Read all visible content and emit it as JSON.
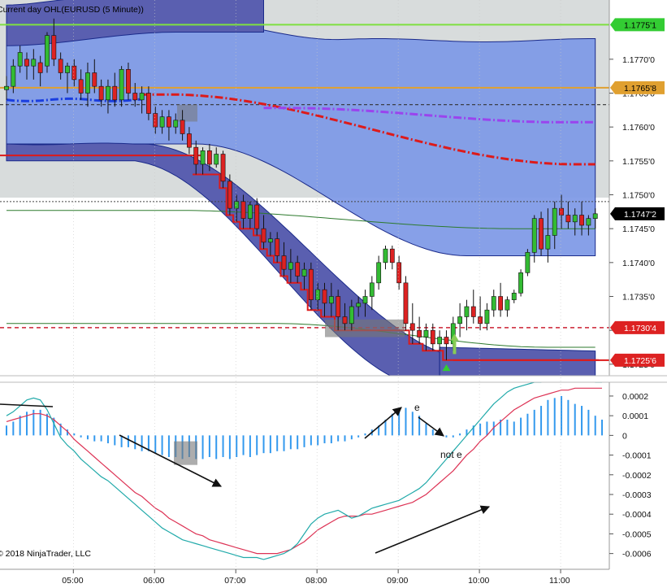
{
  "chart_data": [
    {
      "type": "candlestick",
      "title": "Current day OHL(EURUSD (5 Minute))",
      "ylim": [
        1.17233,
        1.17785
      ],
      "y_ticks": [
        "1.1770'0",
        "1.1765'0",
        "1.1760'0",
        "1.1755'0",
        "1.1750'0",
        "1.1745'0",
        "1.1740'0",
        "1.1735'0",
        "1.1730'0",
        "1.1725'0"
      ],
      "y_tick_values": [
        1.177,
        1.1765,
        1.176,
        1.1755,
        1.175,
        1.1745,
        1.174,
        1.1735,
        1.173,
        1.1725
      ],
      "x_ticks": [
        "05:00",
        "06:00",
        "07:00",
        "08:00",
        "09:00",
        "10:00",
        "11:00"
      ],
      "x_tick_index": [
        10,
        22,
        34,
        46,
        58,
        70,
        82
      ],
      "price_markers": [
        {
          "label": "1.1775'1",
          "value": 1.17751,
          "color": "#33cc33",
          "text_color": "#000000"
        },
        {
          "label": "1.1765'8",
          "value": 1.17658,
          "color": "#e0a030",
          "text_color": "#000000"
        },
        {
          "label": "1.1747'2",
          "value": 1.17472,
          "color": "#000000",
          "text_color": "#ffffff"
        },
        {
          "label": "1.1730'4",
          "value": 1.17304,
          "color": "#dd2222",
          "text_color": "#ffffff"
        },
        {
          "label": "1.1725'6",
          "value": 1.17256,
          "color": "#dd2222",
          "text_color": "#ffffff"
        }
      ],
      "levels": {
        "high": 1.17751,
        "open": 1.17658,
        "dashed_black_1": 1.17633,
        "current_dotted": 1.1749,
        "red_dashed": 1.17304,
        "low_step": 1.17256,
        "blue_bottom": 1.1723
      },
      "candles": [
        {
          "o": 1.17655,
          "h": 1.17675,
          "l": 1.1764,
          "c": 1.1766
        },
        {
          "o": 1.1766,
          "h": 1.177,
          "l": 1.1765,
          "c": 1.1769
        },
        {
          "o": 1.1769,
          "h": 1.1772,
          "l": 1.1768,
          "c": 1.1771
        },
        {
          "o": 1.177,
          "h": 1.1771,
          "l": 1.1767,
          "c": 1.1769
        },
        {
          "o": 1.1769,
          "h": 1.17715,
          "l": 1.1767,
          "c": 1.177
        },
        {
          "o": 1.17695,
          "h": 1.17705,
          "l": 1.1766,
          "c": 1.1768
        },
        {
          "o": 1.1769,
          "h": 1.1774,
          "l": 1.1768,
          "c": 1.17735
        },
        {
          "o": 1.17735,
          "h": 1.1776,
          "l": 1.1769,
          "c": 1.177
        },
        {
          "o": 1.177,
          "h": 1.1771,
          "l": 1.1767,
          "c": 1.1768
        },
        {
          "o": 1.1768,
          "h": 1.17695,
          "l": 1.1765,
          "c": 1.1769
        },
        {
          "o": 1.1769,
          "h": 1.177,
          "l": 1.1766,
          "c": 1.1767
        },
        {
          "o": 1.1767,
          "h": 1.17685,
          "l": 1.1764,
          "c": 1.1765
        },
        {
          "o": 1.1765,
          "h": 1.17695,
          "l": 1.1763,
          "c": 1.1768
        },
        {
          "o": 1.1768,
          "h": 1.177,
          "l": 1.1765,
          "c": 1.1766
        },
        {
          "o": 1.1766,
          "h": 1.1767,
          "l": 1.1763,
          "c": 1.1764
        },
        {
          "o": 1.1764,
          "h": 1.1767,
          "l": 1.1762,
          "c": 1.1766
        },
        {
          "o": 1.1766,
          "h": 1.1768,
          "l": 1.1763,
          "c": 1.1764
        },
        {
          "o": 1.1764,
          "h": 1.1769,
          "l": 1.1763,
          "c": 1.17685
        },
        {
          "o": 1.17685,
          "h": 1.17695,
          "l": 1.1764,
          "c": 1.1765
        },
        {
          "o": 1.1765,
          "h": 1.17665,
          "l": 1.1763,
          "c": 1.1764
        },
        {
          "o": 1.1764,
          "h": 1.1766,
          "l": 1.1762,
          "c": 1.1765
        },
        {
          "o": 1.1765,
          "h": 1.1766,
          "l": 1.1761,
          "c": 1.1762
        },
        {
          "o": 1.1762,
          "h": 1.1763,
          "l": 1.1759,
          "c": 1.176
        },
        {
          "o": 1.176,
          "h": 1.17625,
          "l": 1.1759,
          "c": 1.17615
        },
        {
          "o": 1.17615,
          "h": 1.17625,
          "l": 1.1758,
          "c": 1.176
        },
        {
          "o": 1.176,
          "h": 1.1762,
          "l": 1.1759,
          "c": 1.1761
        },
        {
          "o": 1.1761,
          "h": 1.17625,
          "l": 1.1758,
          "c": 1.1759
        },
        {
          "o": 1.1759,
          "h": 1.176,
          "l": 1.1756,
          "c": 1.1757
        },
        {
          "o": 1.1757,
          "h": 1.1758,
          "l": 1.1753,
          "c": 1.17545
        },
        {
          "o": 1.17545,
          "h": 1.1757,
          "l": 1.1753,
          "c": 1.17565
        },
        {
          "o": 1.17565,
          "h": 1.17575,
          "l": 1.17535,
          "c": 1.17545
        },
        {
          "o": 1.17545,
          "h": 1.1757,
          "l": 1.1754,
          "c": 1.1756
        },
        {
          "o": 1.1756,
          "h": 1.17565,
          "l": 1.1751,
          "c": 1.1752
        },
        {
          "o": 1.1752,
          "h": 1.1753,
          "l": 1.1747,
          "c": 1.1748
        },
        {
          "o": 1.1748,
          "h": 1.175,
          "l": 1.1746,
          "c": 1.1749
        },
        {
          "o": 1.1749,
          "h": 1.175,
          "l": 1.1745,
          "c": 1.17465
        },
        {
          "o": 1.17465,
          "h": 1.1749,
          "l": 1.1745,
          "c": 1.17485
        },
        {
          "o": 1.17485,
          "h": 1.17495,
          "l": 1.1744,
          "c": 1.1745
        },
        {
          "o": 1.1745,
          "h": 1.1747,
          "l": 1.1742,
          "c": 1.1743
        },
        {
          "o": 1.1743,
          "h": 1.17445,
          "l": 1.1741,
          "c": 1.17435
        },
        {
          "o": 1.17435,
          "h": 1.17445,
          "l": 1.174,
          "c": 1.1741
        },
        {
          "o": 1.1741,
          "h": 1.1743,
          "l": 1.1738,
          "c": 1.1739
        },
        {
          "o": 1.1739,
          "h": 1.1742,
          "l": 1.1737,
          "c": 1.174
        },
        {
          "o": 1.174,
          "h": 1.1741,
          "l": 1.1737,
          "c": 1.1738
        },
        {
          "o": 1.1738,
          "h": 1.174,
          "l": 1.1736,
          "c": 1.1739
        },
        {
          "o": 1.1739,
          "h": 1.174,
          "l": 1.1733,
          "c": 1.17345
        },
        {
          "o": 1.17345,
          "h": 1.1737,
          "l": 1.1733,
          "c": 1.1736
        },
        {
          "o": 1.1736,
          "h": 1.1737,
          "l": 1.1732,
          "c": 1.1734
        },
        {
          "o": 1.1734,
          "h": 1.1737,
          "l": 1.1732,
          "c": 1.1735
        },
        {
          "o": 1.1735,
          "h": 1.1736,
          "l": 1.173,
          "c": 1.1732
        },
        {
          "o": 1.1732,
          "h": 1.1734,
          "l": 1.173,
          "c": 1.1731
        },
        {
          "o": 1.1731,
          "h": 1.17345,
          "l": 1.173,
          "c": 1.17335
        },
        {
          "o": 1.17335,
          "h": 1.1735,
          "l": 1.1732,
          "c": 1.1734
        },
        {
          "o": 1.1734,
          "h": 1.1736,
          "l": 1.1732,
          "c": 1.1735
        },
        {
          "o": 1.1735,
          "h": 1.1738,
          "l": 1.1733,
          "c": 1.1737
        },
        {
          "o": 1.1737,
          "h": 1.1741,
          "l": 1.1736,
          "c": 1.174
        },
        {
          "o": 1.174,
          "h": 1.17425,
          "l": 1.1739,
          "c": 1.1742
        },
        {
          "o": 1.1742,
          "h": 1.17425,
          "l": 1.1739,
          "c": 1.174
        },
        {
          "o": 1.174,
          "h": 1.1741,
          "l": 1.1736,
          "c": 1.1737
        },
        {
          "o": 1.1737,
          "h": 1.1738,
          "l": 1.173,
          "c": 1.1731
        },
        {
          "o": 1.1731,
          "h": 1.1734,
          "l": 1.1728,
          "c": 1.173
        },
        {
          "o": 1.173,
          "h": 1.1732,
          "l": 1.1728,
          "c": 1.1729
        },
        {
          "o": 1.1729,
          "h": 1.1731,
          "l": 1.1727,
          "c": 1.173
        },
        {
          "o": 1.173,
          "h": 1.1731,
          "l": 1.1727,
          "c": 1.1728
        },
        {
          "o": 1.1728,
          "h": 1.173,
          "l": 1.1727,
          "c": 1.1729
        },
        {
          "o": 1.1729,
          "h": 1.173,
          "l": 1.17256,
          "c": 1.1728
        },
        {
          "o": 1.1728,
          "h": 1.1732,
          "l": 1.1727,
          "c": 1.1731
        },
        {
          "o": 1.1731,
          "h": 1.1734,
          "l": 1.1729,
          "c": 1.1732
        },
        {
          "o": 1.1732,
          "h": 1.17345,
          "l": 1.173,
          "c": 1.17335
        },
        {
          "o": 1.17335,
          "h": 1.1736,
          "l": 1.1731,
          "c": 1.1732
        },
        {
          "o": 1.1732,
          "h": 1.1735,
          "l": 1.173,
          "c": 1.1731
        },
        {
          "o": 1.1731,
          "h": 1.1734,
          "l": 1.173,
          "c": 1.1733
        },
        {
          "o": 1.1733,
          "h": 1.1736,
          "l": 1.1732,
          "c": 1.1735
        },
        {
          "o": 1.1735,
          "h": 1.1737,
          "l": 1.1732,
          "c": 1.1733
        },
        {
          "o": 1.1733,
          "h": 1.1735,
          "l": 1.1732,
          "c": 1.17345
        },
        {
          "o": 1.17345,
          "h": 1.1736,
          "l": 1.1734,
          "c": 1.17355
        },
        {
          "o": 1.17355,
          "h": 1.1739,
          "l": 1.1735,
          "c": 1.17385
        },
        {
          "o": 1.17385,
          "h": 1.1742,
          "l": 1.1738,
          "c": 1.17415
        },
        {
          "o": 1.17415,
          "h": 1.1747,
          "l": 1.174,
          "c": 1.17465
        },
        {
          "o": 1.17465,
          "h": 1.17475,
          "l": 1.1741,
          "c": 1.1742
        },
        {
          "o": 1.1742,
          "h": 1.1748,
          "l": 1.174,
          "c": 1.1744
        },
        {
          "o": 1.1744,
          "h": 1.1749,
          "l": 1.1742,
          "c": 1.1748
        },
        {
          "o": 1.1748,
          "h": 1.175,
          "l": 1.1745,
          "c": 1.1747
        },
        {
          "o": 1.1747,
          "h": 1.1749,
          "l": 1.1745,
          "c": 1.1746
        },
        {
          "o": 1.1746,
          "h": 1.1748,
          "l": 1.1744,
          "c": 1.1747
        },
        {
          "o": 1.1747,
          "h": 1.1749,
          "l": 1.1744,
          "c": 1.17455
        },
        {
          "o": 1.17455,
          "h": 1.1747,
          "l": 1.1744,
          "c": 1.17465
        },
        {
          "o": 1.17465,
          "h": 1.1748,
          "l": 1.1745,
          "c": 1.17472
        }
      ],
      "up_color": "#33bb33",
      "down_color": "#dd2222"
    },
    {
      "type": "macd",
      "ylim": [
        -0.00068,
        0.00027
      ],
      "y_ticks": [
        "0.0002",
        "0.0001",
        "0",
        "-0.0001",
        "-0.0002",
        "-0.0003",
        "-0.0004",
        "-0.0005",
        "-0.0006"
      ],
      "y_tick_values": [
        0.0002,
        0.0001,
        0,
        -0.0001,
        -0.0002,
        -0.0003,
        -0.0004,
        -0.0005,
        -0.0006
      ],
      "histogram": [
        5e-05,
        7e-05,
        0.0001,
        0.00012,
        0.00013,
        0.00013,
        0.00011,
        9e-05,
        6e-05,
        3e-05,
        1e-05,
        -1e-05,
        -2e-05,
        -3e-05,
        -3e-05,
        -4e-05,
        -5e-05,
        -6e-05,
        -6e-05,
        -7e-05,
        -8e-05,
        -8e-05,
        -9e-05,
        -0.0001,
        -0.00011,
        -0.00011,
        -0.00012,
        -0.00011,
        -0.00012,
        -0.00012,
        -0.00011,
        -0.00012,
        -0.00011,
        -0.00012,
        -0.00011,
        -0.0001,
        -0.00011,
        -0.0001,
        -9e-05,
        -9e-05,
        -8e-05,
        -8e-05,
        -7e-05,
        -7e-05,
        -6e-05,
        -5e-05,
        -5e-05,
        -4e-05,
        -4e-05,
        -3e-05,
        -3e-05,
        -2e-05,
        -1e-05,
        1e-05,
        3e-05,
        5e-05,
        8e-05,
        0.00011,
        0.00013,
        0.00014,
        0.00012,
        0.0001,
        6e-05,
        3e-05,
        1e-05,
        -1e-05,
        -1e-05,
        1e-05,
        3e-05,
        5e-05,
        6e-05,
        7e-05,
        7e-05,
        8e-05,
        8e-05,
        7e-05,
        9e-05,
        0.00011,
        0.00013,
        0.00015,
        0.00018,
        0.00019,
        0.0002,
        0.00018,
        0.00016,
        0.00015,
        0.00013,
        0.0001,
        8e-05
      ],
      "macd_line": [
        0.0001,
        0.00012,
        0.00015,
        0.00018,
        0.00019,
        0.00018,
        0.00013,
        6e-05,
        -1e-05,
        -5e-05,
        -8e-05,
        -0.00012,
        -0.00015,
        -0.00018,
        -0.00021,
        -0.00023,
        -0.00026,
        -0.00029,
        -0.00032,
        -0.00035,
        -0.00038,
        -0.00041,
        -0.00044,
        -0.00047,
        -0.00049,
        -0.00051,
        -0.00053,
        -0.00054,
        -0.00055,
        -0.00056,
        -0.00057,
        -0.00058,
        -0.00059,
        -0.0006,
        -0.00061,
        -0.00062,
        -0.00062,
        -0.00062,
        -0.00063,
        -0.00062,
        -0.00061,
        -0.0006,
        -0.00058,
        -0.00055,
        -0.0005,
        -0.00045,
        -0.00042,
        -0.0004,
        -0.00039,
        -0.00038,
        -0.0004,
        -0.00042,
        -0.00041,
        -0.00039,
        -0.00037,
        -0.00036,
        -0.00035,
        -0.00034,
        -0.00033,
        -0.00031,
        -0.00029,
        -0.00027,
        -0.00024,
        -0.0002,
        -0.00016,
        -0.00012,
        -8e-05,
        -4e-05,
        0.0,
        4e-05,
        8e-05,
        0.00012,
        0.00016,
        0.00019,
        0.00022,
        0.00024,
        0.00025,
        0.00026,
        0.00027,
        0.00027,
        0.00028,
        0.00028,
        0.00029,
        0.00029,
        0.00029,
        0.00028,
        0.00028,
        0.00027,
        0.00027
      ],
      "signal_line": [
        7e-05,
        8e-05,
        9e-05,
        0.0001,
        0.00011,
        0.00011,
        0.0001,
        8e-05,
        5e-05,
        2e-05,
        -2e-05,
        -5e-05,
        -8e-05,
        -0.00011,
        -0.00014,
        -0.00017,
        -0.0002,
        -0.00023,
        -0.00026,
        -0.00029,
        -0.00031,
        -0.00034,
        -0.00037,
        -0.00039,
        -0.00042,
        -0.00044,
        -0.00046,
        -0.00048,
        -0.0005,
        -0.00051,
        -0.00053,
        -0.00054,
        -0.00055,
        -0.00056,
        -0.00057,
        -0.00058,
        -0.00059,
        -0.0006,
        -0.0006,
        -0.0006,
        -0.0006,
        -0.00059,
        -0.00058,
        -0.00056,
        -0.00054,
        -0.00051,
        -0.00048,
        -0.00046,
        -0.00044,
        -0.00042,
        -0.00041,
        -0.00041,
        -0.00041,
        -0.0004,
        -0.0004,
        -0.00039,
        -0.00038,
        -0.00037,
        -0.00036,
        -0.00035,
        -0.00034,
        -0.00032,
        -0.0003,
        -0.00027,
        -0.00024,
        -0.00021,
        -0.00018,
        -0.00014,
        -0.0001,
        -7e-05,
        -3e-05,
        0.0,
        4e-05,
        7e-05,
        0.0001,
        0.00013,
        0.00015,
        0.00017,
        0.00019,
        0.0002,
        0.00021,
        0.00022,
        0.00023,
        0.00023,
        0.00024,
        0.00024,
        0.00024,
        0.00024,
        0.00024
      ],
      "histogram_color": "#3399ee",
      "macd_color": "#22aaaa",
      "signal_color": "#dd3355"
    }
  ],
  "annotations": {
    "e_label": "e",
    "not_e_label": "not e",
    "copyright": "© 2018 NinjaTrader, LLC"
  }
}
